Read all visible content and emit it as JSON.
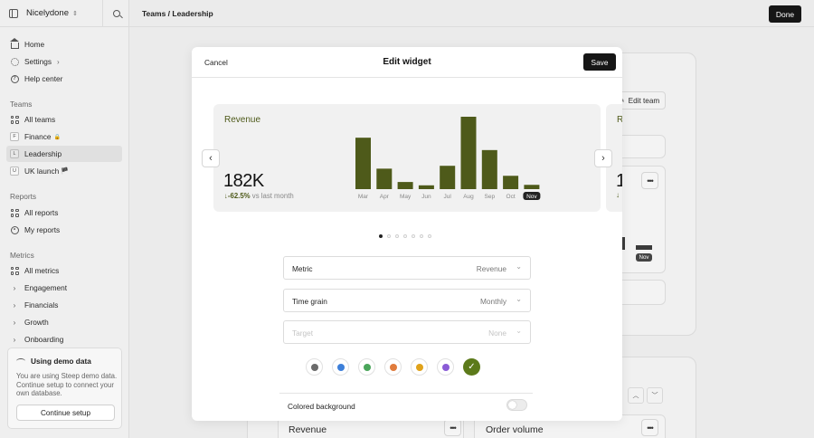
{
  "sidebar": {
    "workspace": "Nicelydone",
    "nav_main": [
      {
        "label": "Home"
      },
      {
        "label": "Settings"
      },
      {
        "label": "Help center"
      }
    ],
    "teams_label": "Teams",
    "teams": [
      {
        "label": "All teams"
      },
      {
        "label": "Finance",
        "badge": "F",
        "suffix": "🔒"
      },
      {
        "label": "Leadership",
        "badge": "L"
      },
      {
        "label": "UK launch",
        "badge": "U",
        "suffix": "🏴"
      }
    ],
    "reports_label": "Reports",
    "reports": [
      {
        "label": "All reports"
      },
      {
        "label": "My reports"
      }
    ],
    "metrics_label": "Metrics",
    "metrics": [
      {
        "label": "All metrics"
      },
      {
        "label": "Engagement"
      },
      {
        "label": "Financials"
      },
      {
        "label": "Growth"
      },
      {
        "label": "Onboarding"
      }
    ],
    "demo": {
      "title": "Using demo data",
      "text": "You are using Steep demo data. Continue setup to connect your own database.",
      "button": "Continue setup"
    }
  },
  "header": {
    "breadcrumb": "Teams / Leadership",
    "done": "Done"
  },
  "background": {
    "edit_team": "Edit team",
    "nov": "Nov",
    "card_revenue": "Revenue",
    "card_orders": "Order volume"
  },
  "modal": {
    "cancel": "Cancel",
    "title": "Edit widget",
    "save": "Save",
    "preview": {
      "title": "Revenue",
      "value": "182K",
      "delta": "-62.5%",
      "delta_suffix": "vs last month",
      "peek_title": "R",
      "peek_value": "1",
      "page_dots": 7,
      "active_dot": 0
    },
    "fields": [
      {
        "label": "Metric",
        "value": "Revenue",
        "disabled": false
      },
      {
        "label": "Time grain",
        "value": "Monthly",
        "disabled": false
      },
      {
        "label": "Target",
        "value": "None",
        "disabled": true
      }
    ],
    "swatches": [
      "#6b6b6b",
      "#3d7fd9",
      "#4aa55a",
      "#e07b3c",
      "#e0a21a",
      "#8a5bd6",
      "#5c7a1a"
    ],
    "selected_swatch": 6,
    "colored_background_label": "Colored background",
    "colored_background_on": false
  },
  "chart_data": {
    "type": "bar",
    "title": "Revenue",
    "categories": [
      "Mar",
      "Apr",
      "May",
      "Jun",
      "Jul",
      "Aug",
      "Sep",
      "Oct",
      "Nov"
    ],
    "values": [
      540,
      215,
      75,
      40,
      245,
      760,
      410,
      140,
      45
    ],
    "highlight_category": "Nov",
    "bar_color": "#4e5a1a"
  }
}
